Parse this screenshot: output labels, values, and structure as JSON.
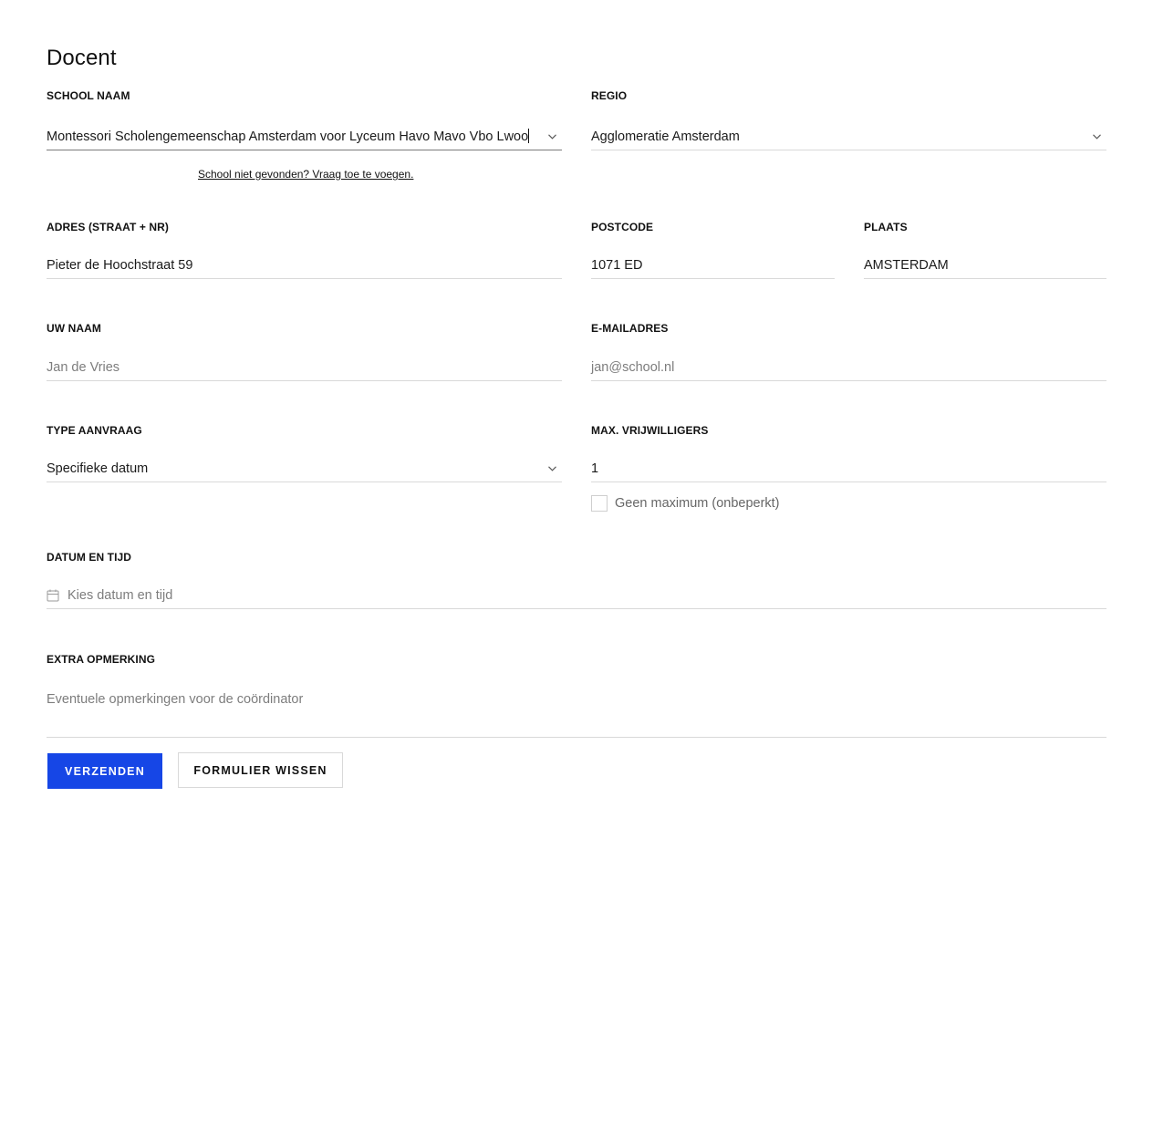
{
  "header": {
    "title": "Docent"
  },
  "school": {
    "label": "SCHOOL NAAM",
    "value": "Montessori Scholengemeenschap Amsterdam voor Lyceum Havo Mavo Vbo Lwoo",
    "hint": "School niet gevonden? Vraag toe te voegen.",
    "icon": "chevron-down-icon"
  },
  "regio": {
    "label": "REGIO",
    "value": "Agglomeratie Amsterdam",
    "icon": "chevron-down-icon"
  },
  "adres": {
    "label": "ADRES (STRAAT + NR)",
    "value": "Pieter de Hoochstraat 59"
  },
  "postcode": {
    "label": "POSTCODE",
    "value": "1071 ED"
  },
  "plaats": {
    "label": "PLAATS",
    "value": "AMSTERDAM"
  },
  "naam": {
    "label": "UW NAAM",
    "placeholder": "Jan de Vries"
  },
  "email": {
    "label": "E-MAILADRES",
    "placeholder": "jan@school.nl"
  },
  "type": {
    "label": "TYPE AANVRAAG",
    "value": "Specifieke datum",
    "icon": "chevron-down-icon"
  },
  "max": {
    "label": "MAX. VRIJWILLIGERS",
    "value": "1",
    "checkbox_label": "Geen maximum (onbeperkt)",
    "checkbox_checked": false
  },
  "datum": {
    "label": "DATUM EN TIJD",
    "placeholder": "Kies datum en tijd",
    "icon": "calendar-icon"
  },
  "opmerking": {
    "label": "EXTRA OPMERKING",
    "placeholder": "Eventuele opmerkingen voor de coördinator"
  },
  "buttons": {
    "submit": "VERZENDEN",
    "clear": "FORMULIER WISSEN"
  },
  "colors": {
    "primary": "#1646e6",
    "border": "#d9d9d9",
    "placeholder": "#7d7d7d"
  }
}
